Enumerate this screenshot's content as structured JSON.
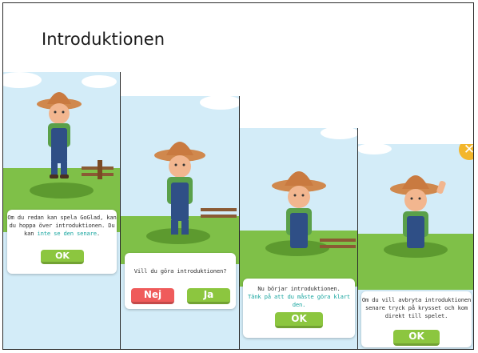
{
  "title": "Introduktionen",
  "panels": [
    {
      "message_line1": "Om du redan kan spela GoGlad, kan",
      "message_line2": "du hoppa över introduktionen. Du",
      "message_line3_prefix": "kan ",
      "message_link": "inte se den senare",
      "message_line3_suffix": ".",
      "ok_label": "OK"
    },
    {
      "message": "Vill du göra introduktionen?",
      "no_label": "Nej",
      "yes_label": "Ja"
    },
    {
      "message_line1": "Nu börjar introduktionen.",
      "message_link": "Tänk på att du måste göra klart den.",
      "ok_label": "OK"
    },
    {
      "message_line1": "Om du vill avbryta introduktionen",
      "message_line2": "senare tryck på krysset och kom",
      "message_line3": "direkt till spelet.",
      "ok_label": "OK",
      "close_symbol": "✕"
    }
  ],
  "colors": {
    "sky": "#cfe9f6",
    "grass": "#7fc048",
    "button_green": "#8cc63f",
    "button_red": "#ef5b5b",
    "link": "#1aa6a0",
    "close": "#f3b62b"
  }
}
